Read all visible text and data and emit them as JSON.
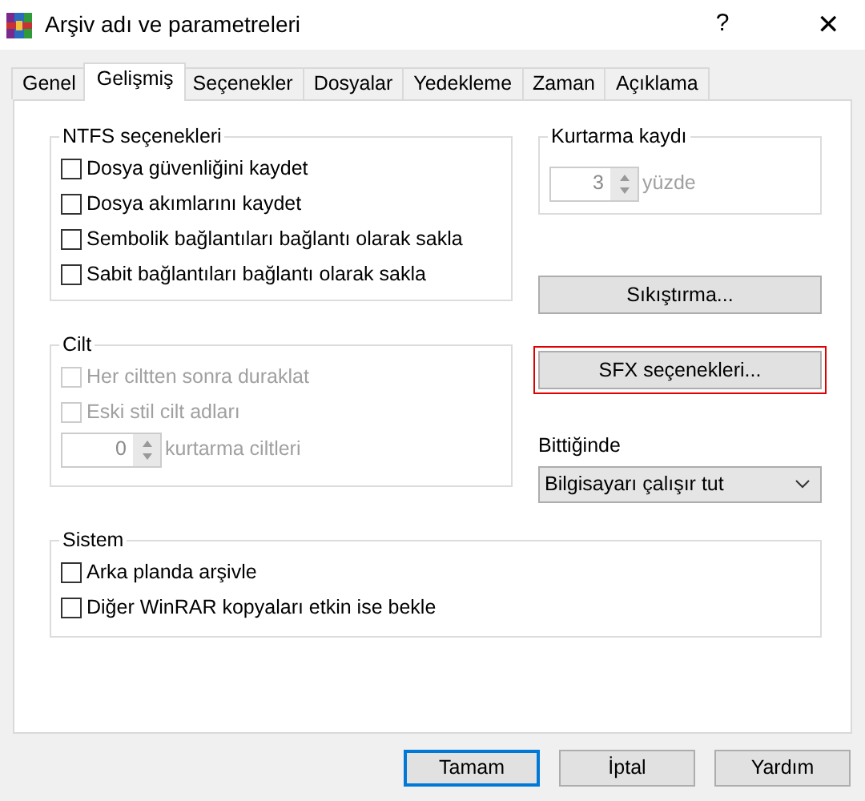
{
  "window": {
    "title": "Arşiv adı ve parametreleri",
    "help": "?",
    "close": "✕"
  },
  "tabs": [
    {
      "label": "Genel",
      "selected": false
    },
    {
      "label": "Gelişmiş",
      "selected": true
    },
    {
      "label": "Seçenekler",
      "selected": false
    },
    {
      "label": "Dosyalar",
      "selected": false
    },
    {
      "label": "Yedekleme",
      "selected": false
    },
    {
      "label": "Zaman",
      "selected": false
    },
    {
      "label": "Açıklama",
      "selected": false
    }
  ],
  "ntfs": {
    "title": "NTFS seçenekleri",
    "options": [
      {
        "label": "Dosya güvenliğini kaydet",
        "checked": false,
        "disabled": false
      },
      {
        "label": "Dosya akımlarını kaydet",
        "checked": false,
        "disabled": false
      },
      {
        "label": "Sembolik bağlantıları bağlantı olarak sakla",
        "checked": false,
        "disabled": false
      },
      {
        "label": "Sabit bağlantıları bağlantı olarak sakla",
        "checked": false,
        "disabled": false
      }
    ]
  },
  "volume": {
    "title": "Cilt",
    "options": [
      {
        "label": "Her ciltten sonra duraklat",
        "checked": false,
        "disabled": true
      },
      {
        "label": "Eski stil cilt adları",
        "checked": false,
        "disabled": true
      }
    ],
    "spinner": {
      "value": "0",
      "label": "kurtarma ciltleri",
      "disabled": true
    }
  },
  "recovery": {
    "title": "Kurtarma kaydı",
    "spinner": {
      "value": "3",
      "label": "yüzde",
      "disabled": true
    }
  },
  "side_buttons": [
    {
      "label": "Sıkıştırma...",
      "highlighted": false
    },
    {
      "label": "SFX seçenekleri...",
      "highlighted": true
    }
  ],
  "finish": {
    "label": "Bittiğinde",
    "value": "Bilgisayarı çalışır tut"
  },
  "system": {
    "title": "Sistem",
    "options": [
      {
        "label": "Arka planda arşivle",
        "checked": false,
        "disabled": false
      },
      {
        "label": "Diğer WinRAR kopyaları etkin ise bekle",
        "checked": false,
        "disabled": false
      }
    ]
  },
  "buttons": [
    {
      "label": "Tamam",
      "default": true
    },
    {
      "label": "İptal",
      "default": false
    },
    {
      "label": "Yardım",
      "default": false
    }
  ]
}
